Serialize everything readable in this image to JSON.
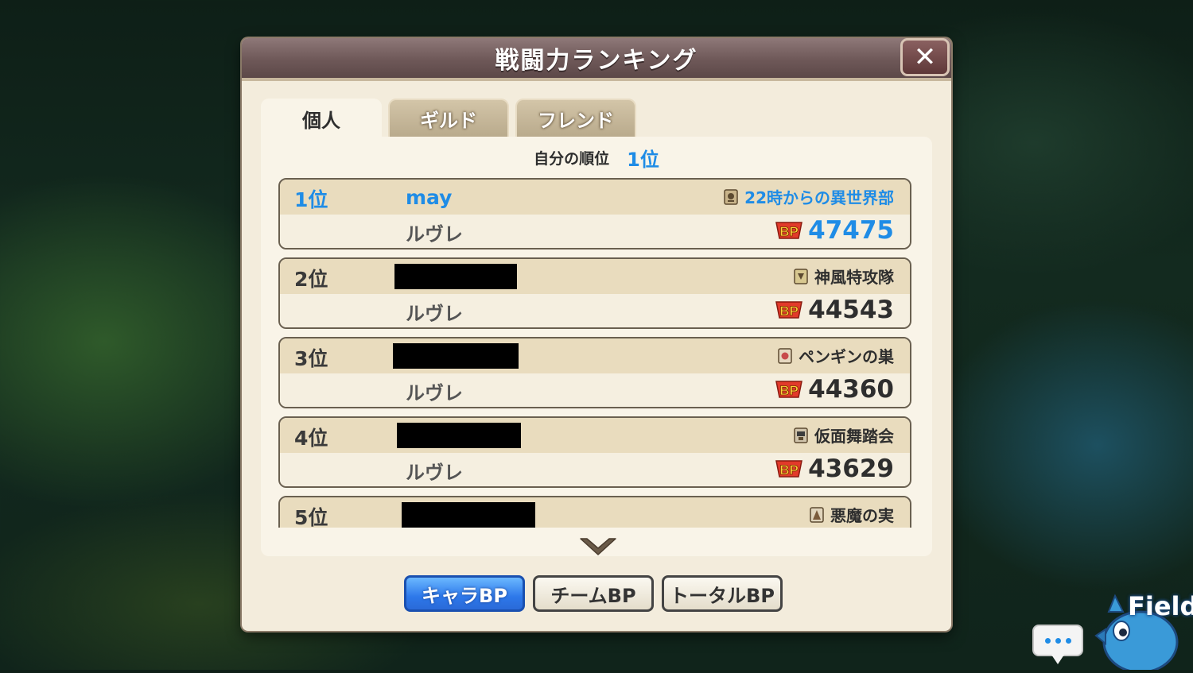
{
  "dialog": {
    "title": "戦闘力ランキング",
    "close_label": "✕"
  },
  "tabs": [
    {
      "label": "個人",
      "active": true
    },
    {
      "label": "ギルド",
      "active": false
    },
    {
      "label": "フレンド",
      "active": false
    }
  ],
  "own_rank": {
    "label": "自分の順位",
    "value": "1位"
  },
  "entries": [
    {
      "rank": "1位",
      "player": "may",
      "player_redacted": false,
      "guild": "22時からの異世界部",
      "character": "ルヴレ",
      "bp": "47475"
    },
    {
      "rank": "2位",
      "player": "",
      "player_redacted": true,
      "guild": "神風特攻隊",
      "character": "ルヴレ",
      "bp": "44543"
    },
    {
      "rank": "3位",
      "player": "",
      "player_redacted": true,
      "guild": "ペンギンの巣",
      "character": "ルヴレ",
      "bp": "44360"
    },
    {
      "rank": "4位",
      "player": "",
      "player_redacted": true,
      "guild": "仮面舞踏会",
      "character": "ルヴレ",
      "bp": "43629"
    },
    {
      "rank": "5位",
      "player": "",
      "player_redacted": true,
      "guild": "悪魔の実",
      "character": "",
      "bp": ""
    }
  ],
  "bp_badge": "BP",
  "bottom_buttons": [
    {
      "label": "キャラBP",
      "active": true
    },
    {
      "label": "チームBP",
      "active": false
    },
    {
      "label": "トータルBP",
      "active": false
    }
  ],
  "overlay": {
    "field_label": "Field"
  },
  "colors": {
    "accent_blue": "#1f8ce6",
    "title_bar": "#6e5858",
    "panel": "#f9f4e8"
  },
  "icons": [
    "close-icon",
    "guild-emblem-icon",
    "bp-badge-icon",
    "chevron-down-icon",
    "chat-icon",
    "field-mascot-icon"
  ]
}
